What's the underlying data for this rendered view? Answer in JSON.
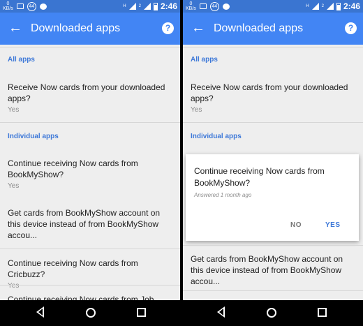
{
  "status_bar": {
    "net_top": "0",
    "net_unit": "KB/s",
    "notif_count": "44",
    "sim1_label": "1",
    "sim1_tag": "H",
    "sim2_label": "2",
    "time": "2:46"
  },
  "toolbar": {
    "title": "Downloaded apps",
    "help_glyph": "?",
    "back_glyph": "←"
  },
  "left": {
    "section_all": "All apps",
    "all_item_title": "Receive Now cards from your downloaded apps?",
    "all_item_sub": "Yes",
    "section_individual": "Individual apps",
    "items": [
      {
        "title": "Continue receiving Now cards from BookMyShow?",
        "sub": "Yes"
      },
      {
        "title": "Get cards from BookMyShow account on this device instead of from BookMyShow accou...",
        "sub": ""
      },
      {
        "title": "Continue receiving Now cards from Cricbuzz?",
        "sub": "Yes"
      },
      {
        "title": "Continue receiving Now cards from Job",
        "sub": ""
      }
    ]
  },
  "right": {
    "section_all": "All apps",
    "all_item_title": "Receive Now cards from your downloaded apps?",
    "all_item_sub": "Yes",
    "section_individual": "Individual apps",
    "dialog": {
      "title": "Continue receiving Now cards from BookMyShow?",
      "subtitle": "Answered 1 month ago",
      "no_label": "NO",
      "yes_label": "YES"
    },
    "items": [
      {
        "title": "Get cards from BookMyShow account on this device instead of from BookMyShow accou...",
        "sub": ""
      }
    ]
  },
  "colors": {
    "status_bar": "#3a75d1",
    "toolbar": "#4285f4",
    "accent": "#3d78d8",
    "background": "#eeeeee"
  }
}
